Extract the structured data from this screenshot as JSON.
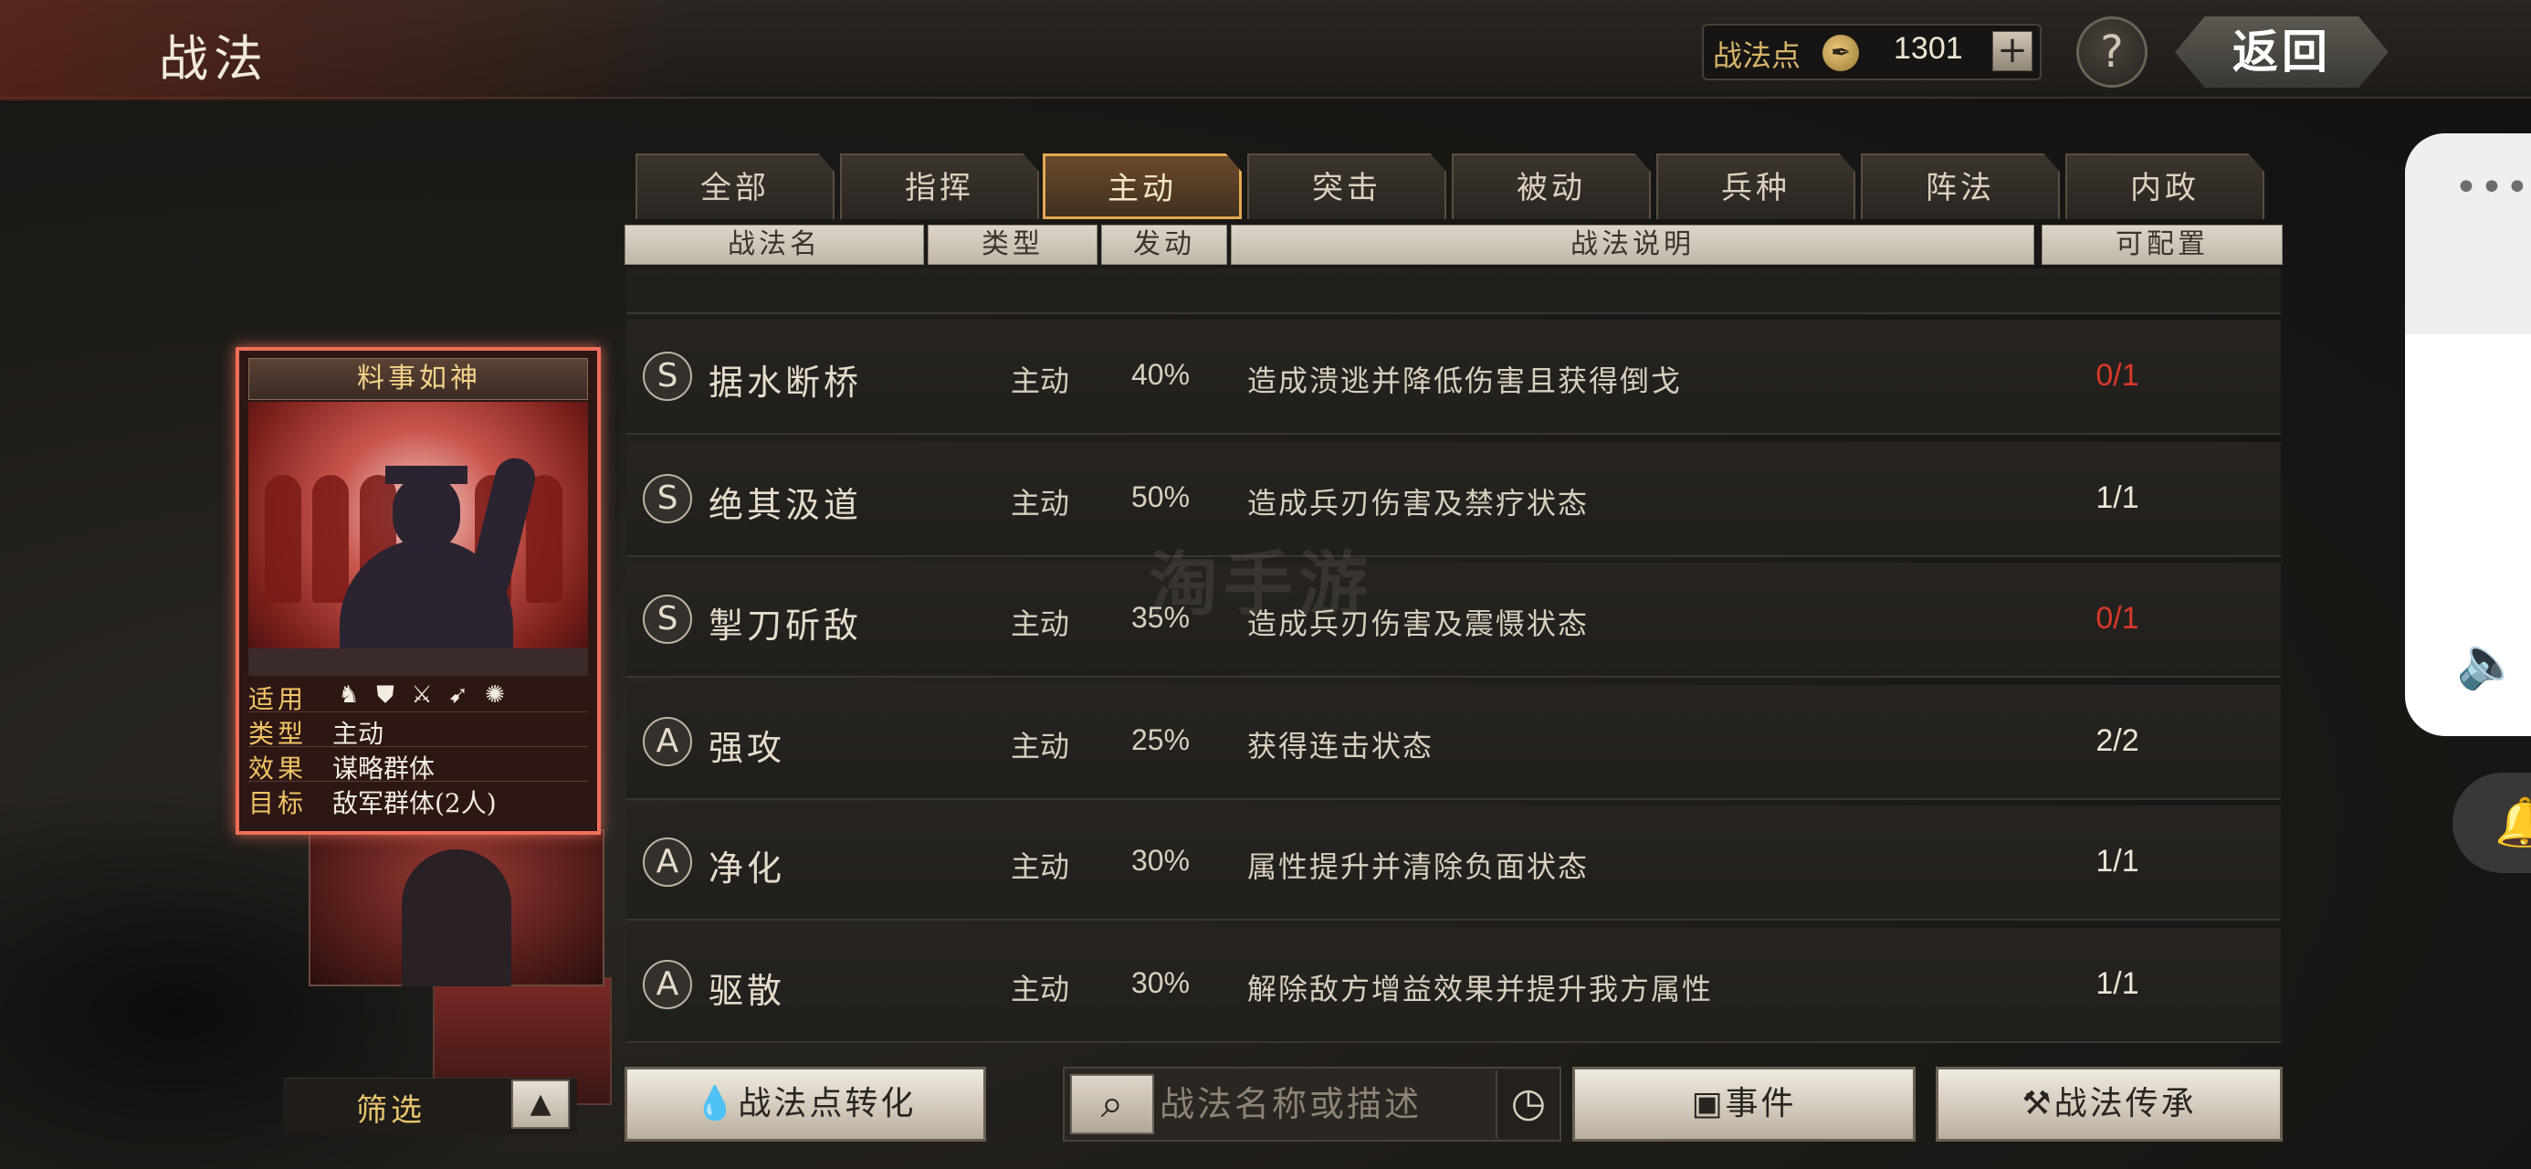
{
  "header": {
    "title": "战法",
    "points_label": "战法点",
    "points_icon": "feather-coin-icon",
    "points_value": "1301",
    "plus_label": "+",
    "help_label": "?",
    "back_label": "返回"
  },
  "side_overlay": {
    "dots": "•••",
    "speaker": "🔈",
    "bell": "🔔"
  },
  "tabs": [
    {
      "label": "全部",
      "active": false
    },
    {
      "label": "指挥",
      "active": false
    },
    {
      "label": "主动",
      "active": true
    },
    {
      "label": "突击",
      "active": false
    },
    {
      "label": "被动",
      "active": false
    },
    {
      "label": "兵种",
      "active": false
    },
    {
      "label": "阵法",
      "active": false
    },
    {
      "label": "内政",
      "active": false
    }
  ],
  "table": {
    "headers": [
      "战法名",
      "类型",
      "发动",
      "战法说明",
      "可配置"
    ],
    "rows": [
      {
        "grade": "S",
        "name": "据水断桥",
        "type": "主动",
        "rate": "40%",
        "desc": "造成溃逃并降低伤害且获得倒戈",
        "conf": "0/1",
        "conf_color": "#d9382a"
      },
      {
        "grade": "S",
        "name": "绝其汲道",
        "type": "主动",
        "rate": "50%",
        "desc": "造成兵刃伤害及禁疗状态",
        "conf": "1/1",
        "conf_color": "#ece4d4"
      },
      {
        "grade": "S",
        "name": "掣刀斫敌",
        "type": "主动",
        "rate": "35%",
        "desc": "造成兵刃伤害及震慑状态",
        "conf": "0/1",
        "conf_color": "#d9382a"
      },
      {
        "grade": "A",
        "name": "强攻",
        "type": "主动",
        "rate": "25%",
        "desc": "获得连击状态",
        "conf": "2/2",
        "conf_color": "#ece4d4"
      },
      {
        "grade": "A",
        "name": "净化",
        "type": "主动",
        "rate": "30%",
        "desc": "属性提升并清除负面状态",
        "conf": "1/1",
        "conf_color": "#ece4d4"
      },
      {
        "grade": "A",
        "name": "驱散",
        "type": "主动",
        "rate": "30%",
        "desc": "解除敌方增益效果并提升我方属性",
        "conf": "1/1",
        "conf_color": "#ece4d4"
      }
    ]
  },
  "watermark": "淘手游",
  "card": {
    "title": "料事如神",
    "apply_label": "适用",
    "apply_icons": [
      "cavalry-icon",
      "shield-icon",
      "crossed-bows-icon",
      "spear-icon",
      "wheel-icon"
    ],
    "type_label": "类型",
    "type_value": "主动",
    "effect_label": "效果",
    "effect_value": "谋略群体",
    "target_label": "目标",
    "target_value": "敌军群体(2人)"
  },
  "bottom": {
    "filter_label": "筛选",
    "filter_toggle": "▲",
    "convert_label": "战法点转化",
    "search_placeholder": "战法名称或描述",
    "event_label": "事件",
    "inherit_label": "战法传承"
  }
}
